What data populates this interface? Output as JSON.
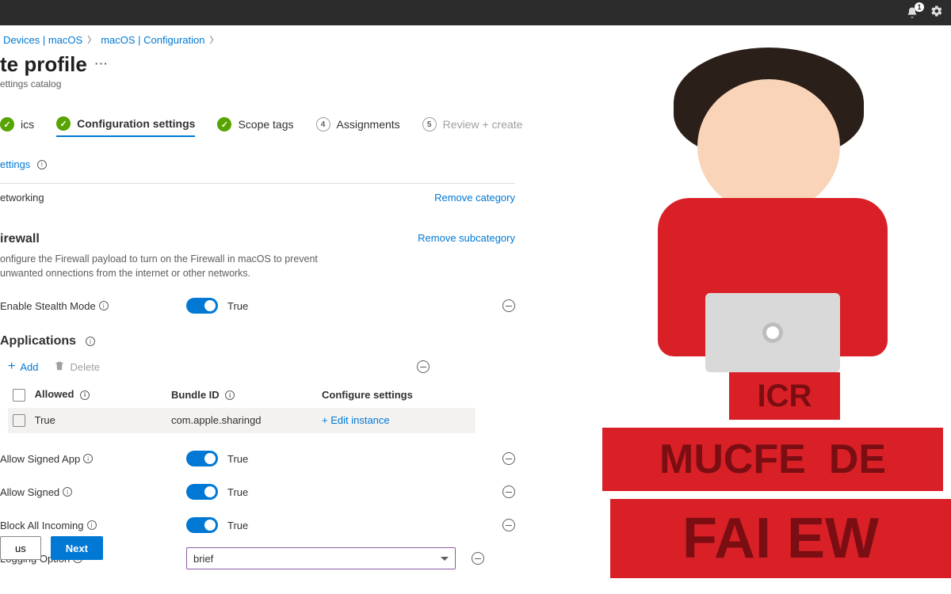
{
  "topbar": {
    "notification_count": "1"
  },
  "breadcrumb": {
    "items": [
      "Devices | macOS",
      "macOS | Configuration"
    ]
  },
  "header": {
    "title_fragment": "te profile",
    "subtitle_fragment": "ettings catalog"
  },
  "tabs": {
    "basics": "ics",
    "config": "Configuration settings",
    "scope": "Scope tags",
    "assignments": "Assignments",
    "step4": "4",
    "review": "Review + create",
    "step5": "5"
  },
  "settings_link": "ettings",
  "category": {
    "label": "etworking",
    "remove": "Remove category"
  },
  "subcategory": {
    "title": "irewall",
    "remove": "Remove subcategory",
    "desc": "onfigure the Firewall payload to turn on the Firewall in macOS to prevent unwanted onnections from the internet or other networks."
  },
  "settings": {
    "stealth": {
      "label": "Enable Stealth Mode",
      "value": "True"
    },
    "apps_title": "Applications",
    "toolbar": {
      "add": "Add",
      "delete": "Delete"
    },
    "columns": {
      "allowed": "Allowed",
      "bundle": "Bundle ID",
      "configure": "Configure settings"
    },
    "row": {
      "allowed": "True",
      "bundle": "com.apple.sharingd",
      "edit": "+ Edit instance"
    },
    "allow_signed_app": {
      "label": "Allow Signed App",
      "value": "True"
    },
    "allow_signed": {
      "label": "Allow Signed",
      "value": "True"
    },
    "block_all": {
      "label": "Block All Incoming",
      "value": "True"
    },
    "logging": {
      "label": "Logging Option",
      "value": "brief"
    }
  },
  "footer": {
    "prev": "us",
    "next": "Next"
  }
}
